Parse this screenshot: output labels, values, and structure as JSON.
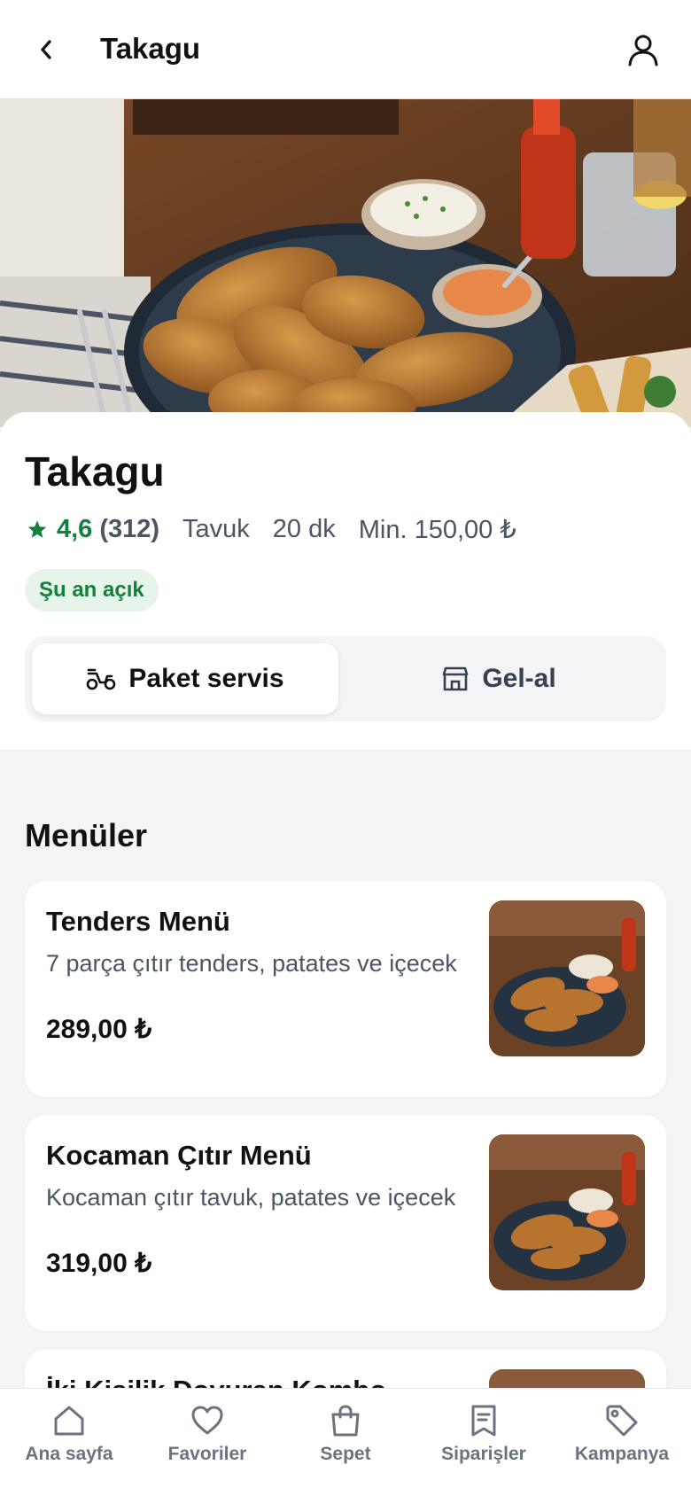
{
  "header": {
    "title": "Takagu"
  },
  "restaurant": {
    "name": "Takagu",
    "rating": "4,6",
    "review_count": "(312)",
    "category": "Tavuk",
    "delivery_time": "20 dk",
    "min_order": "Min. 150,00 ₺",
    "status": "Şu an açık"
  },
  "delivery_toggle": {
    "options": [
      {
        "label": "Paket servis",
        "icon": "scooter-icon",
        "selected": true
      },
      {
        "label": "Gel-al",
        "icon": "store-icon",
        "selected": false
      }
    ]
  },
  "menus": {
    "title": "Menüler",
    "items": [
      {
        "name": "Tenders Menü",
        "description": "7 parça çıtır tenders, patates ve içecek",
        "price": "289,00 ₺"
      },
      {
        "name": "Kocaman Çıtır Menü",
        "description": "Kocaman çıtır tavuk, patates ve içecek",
        "price": "319,00 ₺"
      },
      {
        "name": "İki Kişilik Doyuran Kombo",
        "description": "",
        "price": ""
      }
    ]
  },
  "bottom_nav": {
    "items": [
      {
        "label": "Ana sayfa",
        "icon": "home-icon"
      },
      {
        "label": "Favoriler",
        "icon": "heart-icon"
      },
      {
        "label": "Sepet",
        "icon": "bag-icon"
      },
      {
        "label": "Siparişler",
        "icon": "receipt-icon"
      },
      {
        "label": "Kampanya",
        "icon": "tag-icon"
      }
    ]
  },
  "colors": {
    "accent_green": "#15803d",
    "badge_bg": "#e6f4ea",
    "page_bg": "#f3f4f6"
  }
}
